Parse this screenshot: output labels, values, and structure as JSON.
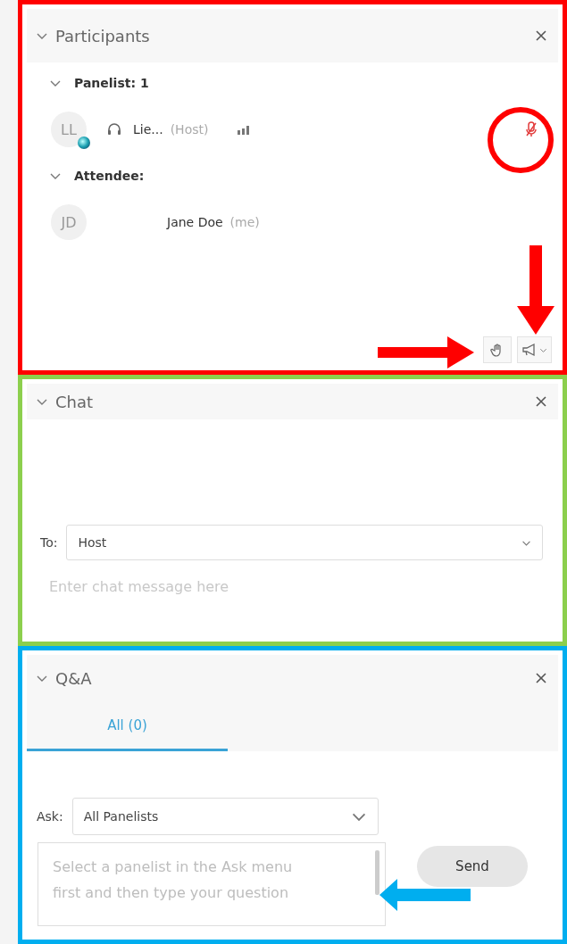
{
  "participants": {
    "title": "Participants",
    "color": "#ff0000",
    "groups": [
      {
        "label": "Panelist: 1",
        "expanded": true,
        "members": [
          {
            "initials": "LL",
            "name": "Lie...",
            "role": "(Host)",
            "kind": "host",
            "mic_muted": true
          }
        ]
      },
      {
        "label": "Attendee:",
        "expanded": true,
        "members": [
          {
            "initials": "JD",
            "name": "Jane Doe",
            "role": "(me)",
            "kind": "attendee"
          }
        ]
      }
    ]
  },
  "chat": {
    "title": "Chat",
    "color": "#8ccf4d",
    "to_label": "To:",
    "to_value": "Host",
    "placeholder": "Enter chat message here"
  },
  "qa": {
    "title": "Q&A",
    "color": "#00aeef",
    "tabs": [
      {
        "label": "All (0)",
        "selected": true
      }
    ],
    "ask_label": "Ask:",
    "ask_value": "All Panelists",
    "placeholder": "Select a panelist in the Ask menu first and then type your question",
    "send": "Send"
  }
}
